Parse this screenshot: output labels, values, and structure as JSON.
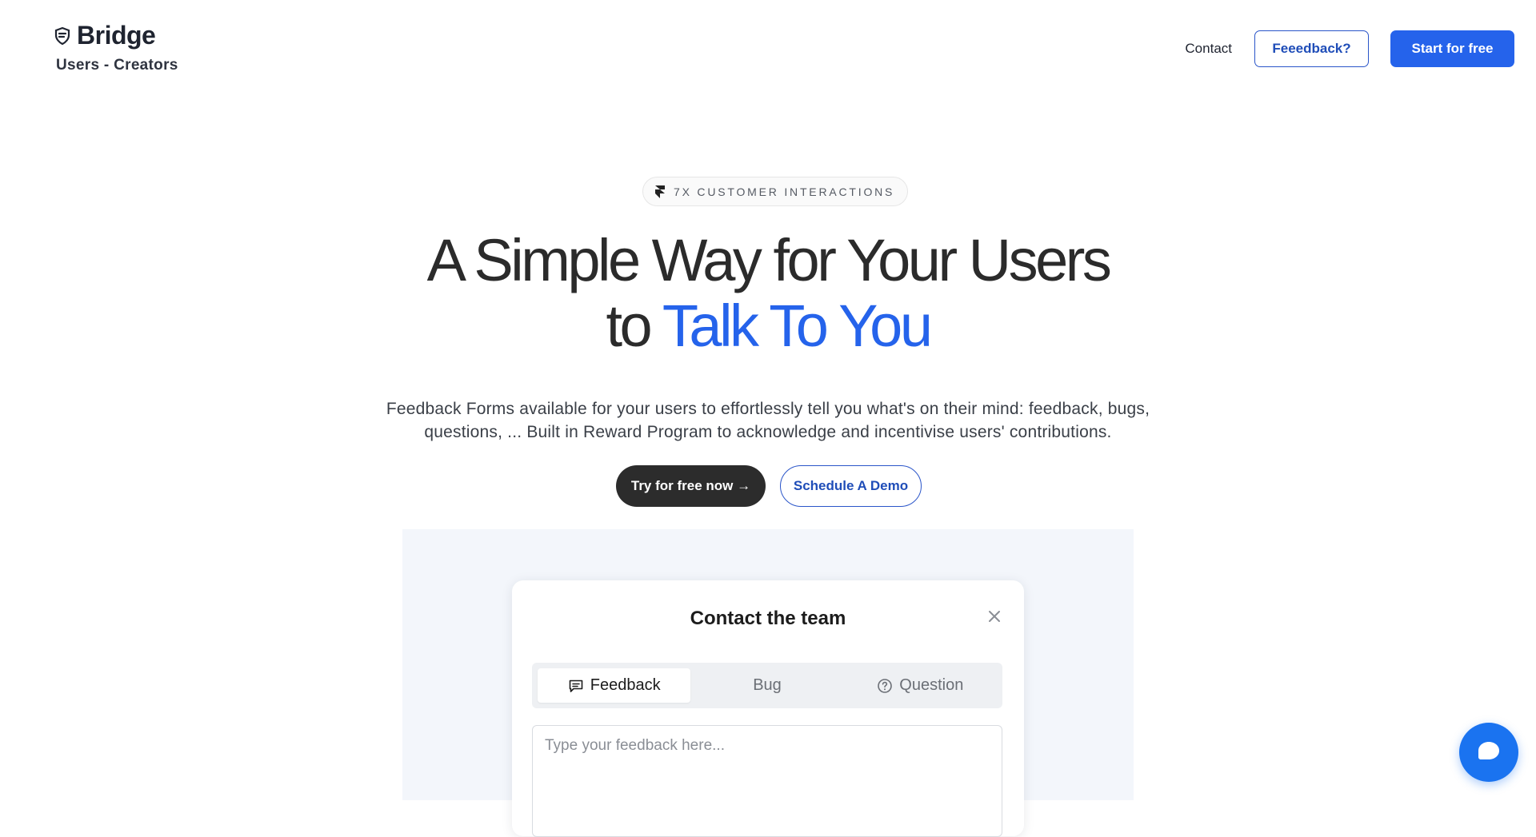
{
  "header": {
    "brand_name": "Bridge",
    "brand_tagline": "Users - Creators",
    "brand_icon": "shield-stack-icon",
    "nav": {
      "contact_label": "Contact",
      "feedback_label": "Feeedback?",
      "start_label": "Start for free"
    }
  },
  "hero": {
    "badge_icon": "framer-icon",
    "badge_text": "7X CUSTOMER INTERACTIONS",
    "headline_line1": "A Simple Way for Your Users",
    "headline_line2_prefix": "to ",
    "headline_line2_accent": "Talk To You",
    "subtext_line1": "Feedback Forms available for your users to effortlessly tell you what's on their mind: feedback, bugs,",
    "subtext_line2": "questions, ... Built in Reward Program to acknowledge and incentivise users' contributions.",
    "primary_cta": "Try for free now →",
    "secondary_cta": "Schedule A Demo"
  },
  "preview": {
    "modal_title": "Contact the team",
    "close_icon": "close-icon",
    "tabs": [
      {
        "label": "Feedback",
        "icon": "message-square-icon",
        "active": true
      },
      {
        "label": "Bug",
        "icon": "",
        "active": false
      },
      {
        "label": "Question",
        "icon": "help-circle-icon",
        "active": false
      }
    ],
    "textarea_placeholder": "Type your feedback here...",
    "textarea_value": ""
  },
  "chat": {
    "icon": "chat-bubble-icon"
  },
  "colors": {
    "accent": "#2563eb",
    "brand_outline": "#2a55c9",
    "dark_button": "#2c2c2c",
    "preview_bg": "#f3f6fb",
    "chat_button": "#1a73f0"
  }
}
